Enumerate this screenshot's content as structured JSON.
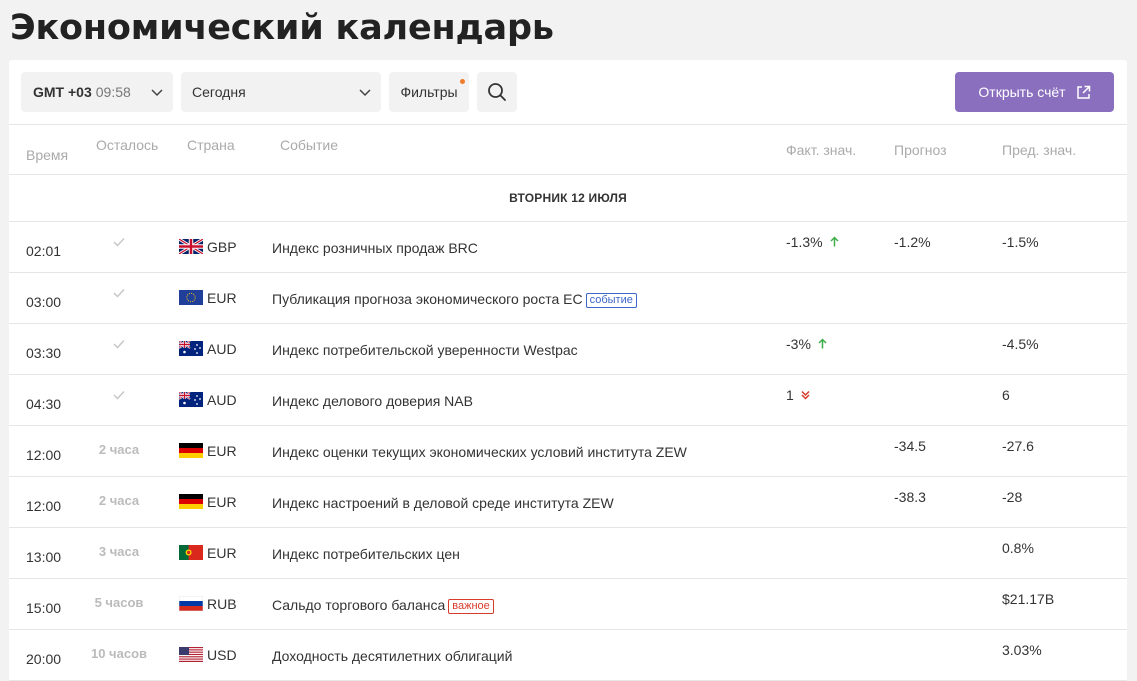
{
  "page": {
    "title": "Экономический календарь"
  },
  "toolbar": {
    "timezone_label": "GMT +03",
    "timezone_time": "09:58",
    "day_select": "Сегодня",
    "filters_label": "Фильтры",
    "open_account_label": "Открыть счёт"
  },
  "columns": {
    "time": "Время",
    "remaining": "Осталось",
    "country": "Страна",
    "event": "Событие",
    "actual": "Факт. знач.",
    "forecast": "Прогноз",
    "previous": "Пред. знач."
  },
  "date_header": "ВТОРНИК 12 ИЮЛЯ",
  "colors": {
    "accent": "#8b6fbf",
    "up": "#3fae49",
    "down": "#d83b2a",
    "tag_event": "#3a67c8",
    "tag_important": "#d83b2a",
    "filters_dot": "#f07b2a"
  },
  "events": [
    {
      "time": "02:01",
      "remaining": "",
      "passed": true,
      "flag": "gb",
      "currency": "GBP",
      "event": "Индекс розничных продаж BRC",
      "tag": "",
      "actual": "-1.3%",
      "trend": "up",
      "forecast": "-1.2%",
      "previous": "-1.5%"
    },
    {
      "time": "03:00",
      "remaining": "",
      "passed": true,
      "flag": "eu",
      "currency": "EUR",
      "event": "Публикация прогноза экономического роста ЕС",
      "tag": "событие",
      "actual": "",
      "trend": "",
      "forecast": "",
      "previous": ""
    },
    {
      "time": "03:30",
      "remaining": "",
      "passed": true,
      "flag": "au",
      "currency": "AUD",
      "event": "Индекс потребительской уверенности Westpac",
      "tag": "",
      "actual": "-3%",
      "trend": "up",
      "forecast": "",
      "previous": "-4.5%"
    },
    {
      "time": "04:30",
      "remaining": "",
      "passed": true,
      "flag": "au",
      "currency": "AUD",
      "event": "Индекс делового доверия NAB",
      "tag": "",
      "actual": "1",
      "trend": "down",
      "forecast": "",
      "previous": "6"
    },
    {
      "time": "12:00",
      "remaining": "2 часа",
      "passed": false,
      "flag": "de",
      "currency": "EUR",
      "event": "Индекс оценки текущих экономических условий института ZEW",
      "tag": "",
      "actual": "",
      "trend": "",
      "forecast": "-34.5",
      "previous": "-27.6"
    },
    {
      "time": "12:00",
      "remaining": "2 часа",
      "passed": false,
      "flag": "de",
      "currency": "EUR",
      "event": "Индекс настроений в деловой среде института ZEW",
      "tag": "",
      "actual": "",
      "trend": "",
      "forecast": "-38.3",
      "previous": "-28"
    },
    {
      "time": "13:00",
      "remaining": "3 часа",
      "passed": false,
      "flag": "pt",
      "currency": "EUR",
      "event": "Индекс потребительских цен",
      "tag": "",
      "actual": "",
      "trend": "",
      "forecast": "",
      "previous": "0.8%"
    },
    {
      "time": "15:00",
      "remaining": "5 часов",
      "passed": false,
      "flag": "ru",
      "currency": "RUB",
      "event": "Сальдо торгового баланса",
      "tag": "важное",
      "actual": "",
      "trend": "",
      "forecast": "",
      "previous": "$21.17B"
    },
    {
      "time": "20:00",
      "remaining": "10 часов",
      "passed": false,
      "flag": "us",
      "currency": "USD",
      "event": "Доходность десятилетних облигаций",
      "tag": "",
      "actual": "",
      "trend": "",
      "forecast": "",
      "previous": "3.03%"
    }
  ]
}
